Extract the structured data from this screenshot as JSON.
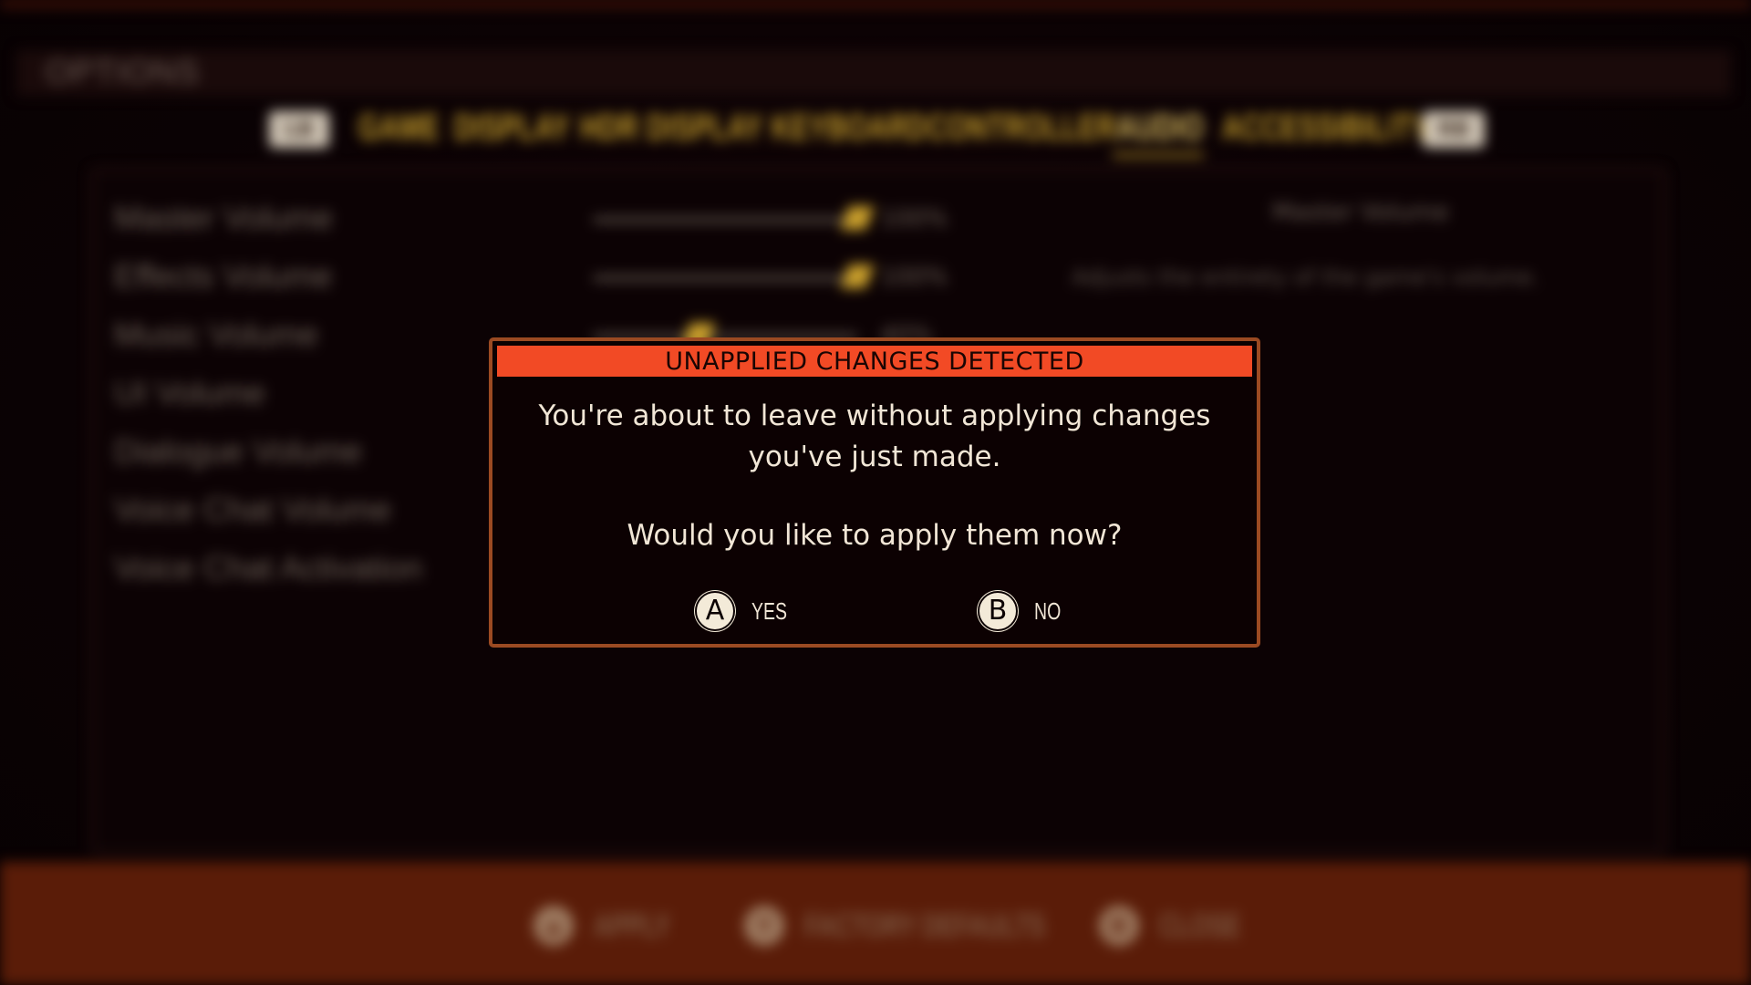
{
  "screen": {
    "title": "OPTIONS",
    "tabs": [
      "GAME",
      "DISPLAY",
      "HDR DISPLAY",
      "KEYBOARD",
      "CONTROLLER",
      "AUDIO",
      "ACCESSIBILITY"
    ],
    "active_tab": "AUDIO",
    "bumper_left": "LB",
    "bumper_right": "RB"
  },
  "settings": [
    {
      "label": "Master Volume",
      "value": "100%",
      "level": 1.0
    },
    {
      "label": "Effects Volume",
      "value": "100%",
      "level": 1.0
    },
    {
      "label": "Music Volume",
      "value": "40%",
      "level": 0.4
    },
    {
      "label": "UI Volume"
    },
    {
      "label": "Dialogue Volume"
    },
    {
      "label": "Voice Chat Volume"
    },
    {
      "label": "Voice Chat Activation"
    }
  ],
  "description": {
    "title": "Master Volume",
    "text": "Adjusts the entirety of the game's volume."
  },
  "footer": {
    "apply_label": "APPLY",
    "defaults_glyph": "Y",
    "defaults_label": "FACTORY DEFAULTS",
    "close_glyph": "B",
    "close_label": "CLOSE"
  },
  "dialog": {
    "title": "UNAPPLIED CHANGES DETECTED",
    "message_line1": "You're about to leave without applying changes",
    "message_line2": "you've just made.",
    "question": "Would you like to apply them now?",
    "yes_glyph": "A",
    "yes_label": "YES",
    "no_glyph": "B",
    "no_label": "NO"
  },
  "colors": {
    "dialog_header": "#f24a25",
    "dialog_border": "#9b4a22",
    "tab_text": "#caa02c",
    "footer_bar": "#5a1c08"
  }
}
